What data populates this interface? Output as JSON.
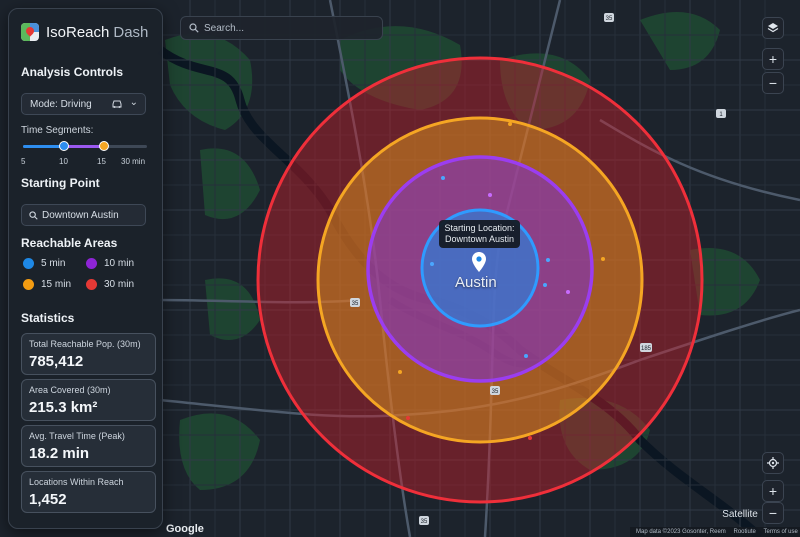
{
  "app": {
    "name": "IsoReach",
    "suffix": "Dash"
  },
  "controls": {
    "title": "Analysis Controls",
    "mode_label": "Mode: Driving",
    "time_segments_label": "Time Segments:",
    "ticks": [
      "5",
      "10",
      "15",
      "30 min"
    ],
    "selected_values_min": [
      10,
      15
    ]
  },
  "starting_point": {
    "title": "Starting Point",
    "value": "Downtown Austin"
  },
  "reachable": {
    "title": "Reachable Areas",
    "items": [
      {
        "label": "5 min",
        "color": "#1e88e5"
      },
      {
        "label": "10 min",
        "color": "#8e24d6"
      },
      {
        "label": "15 min",
        "color": "#f39c12"
      },
      {
        "label": "30 min",
        "color": "#e53935"
      }
    ]
  },
  "statistics": {
    "title": "Statistics",
    "cards": [
      {
        "label": "Total Reachable Pop. (30m)",
        "value": "785,412"
      },
      {
        "label": "Area Covered (30m)",
        "value": "215.3 km²"
      },
      {
        "label": "Avg. Travel Time (Peak)",
        "value": "18.2 min"
      },
      {
        "label": "Locations Within Reach",
        "value": "1,452"
      }
    ]
  },
  "map": {
    "search_placeholder": "Search...",
    "tooltip_line1": "Starting Location:",
    "tooltip_line2": "Downtown Austin",
    "city_label": "Austin",
    "satellite_label": "Satellite",
    "google_label": "Google",
    "attribution": [
      "Map data ©2023 Gosonter, Reem",
      "Rootiute",
      "Terms of use"
    ],
    "highway_shields": [
      "35",
      "35",
      "35",
      "35",
      "185",
      "1"
    ],
    "zoom_in": "+",
    "zoom_out": "−"
  }
}
